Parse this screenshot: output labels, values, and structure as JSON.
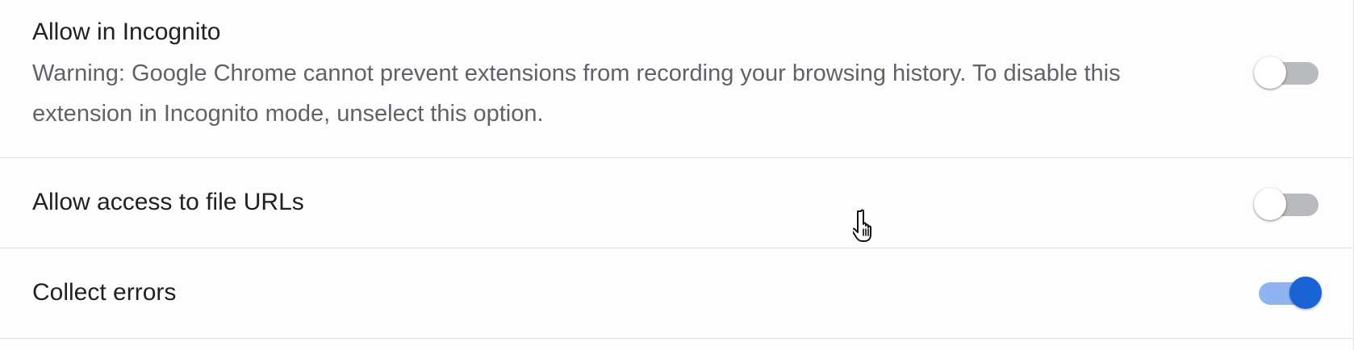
{
  "settings": {
    "incognito": {
      "label": "Allow in Incognito",
      "warning": "Warning: Google Chrome cannot prevent extensions from recording your browsing history. To disable this extension in Incognito mode, unselect this option.",
      "enabled": false
    },
    "file_urls": {
      "label": "Allow access to file URLs",
      "enabled": false
    },
    "collect_errors": {
      "label": "Collect errors",
      "enabled": true
    }
  },
  "colors": {
    "toggle_on_knob": "#1a63d4",
    "toggle_on_track": "#90b4f1",
    "toggle_off_track": "#b8babd",
    "label_text": "#202124",
    "secondary_text": "#5f6368"
  },
  "icons": {
    "cursor": "hand-pointer-cursor-icon"
  }
}
